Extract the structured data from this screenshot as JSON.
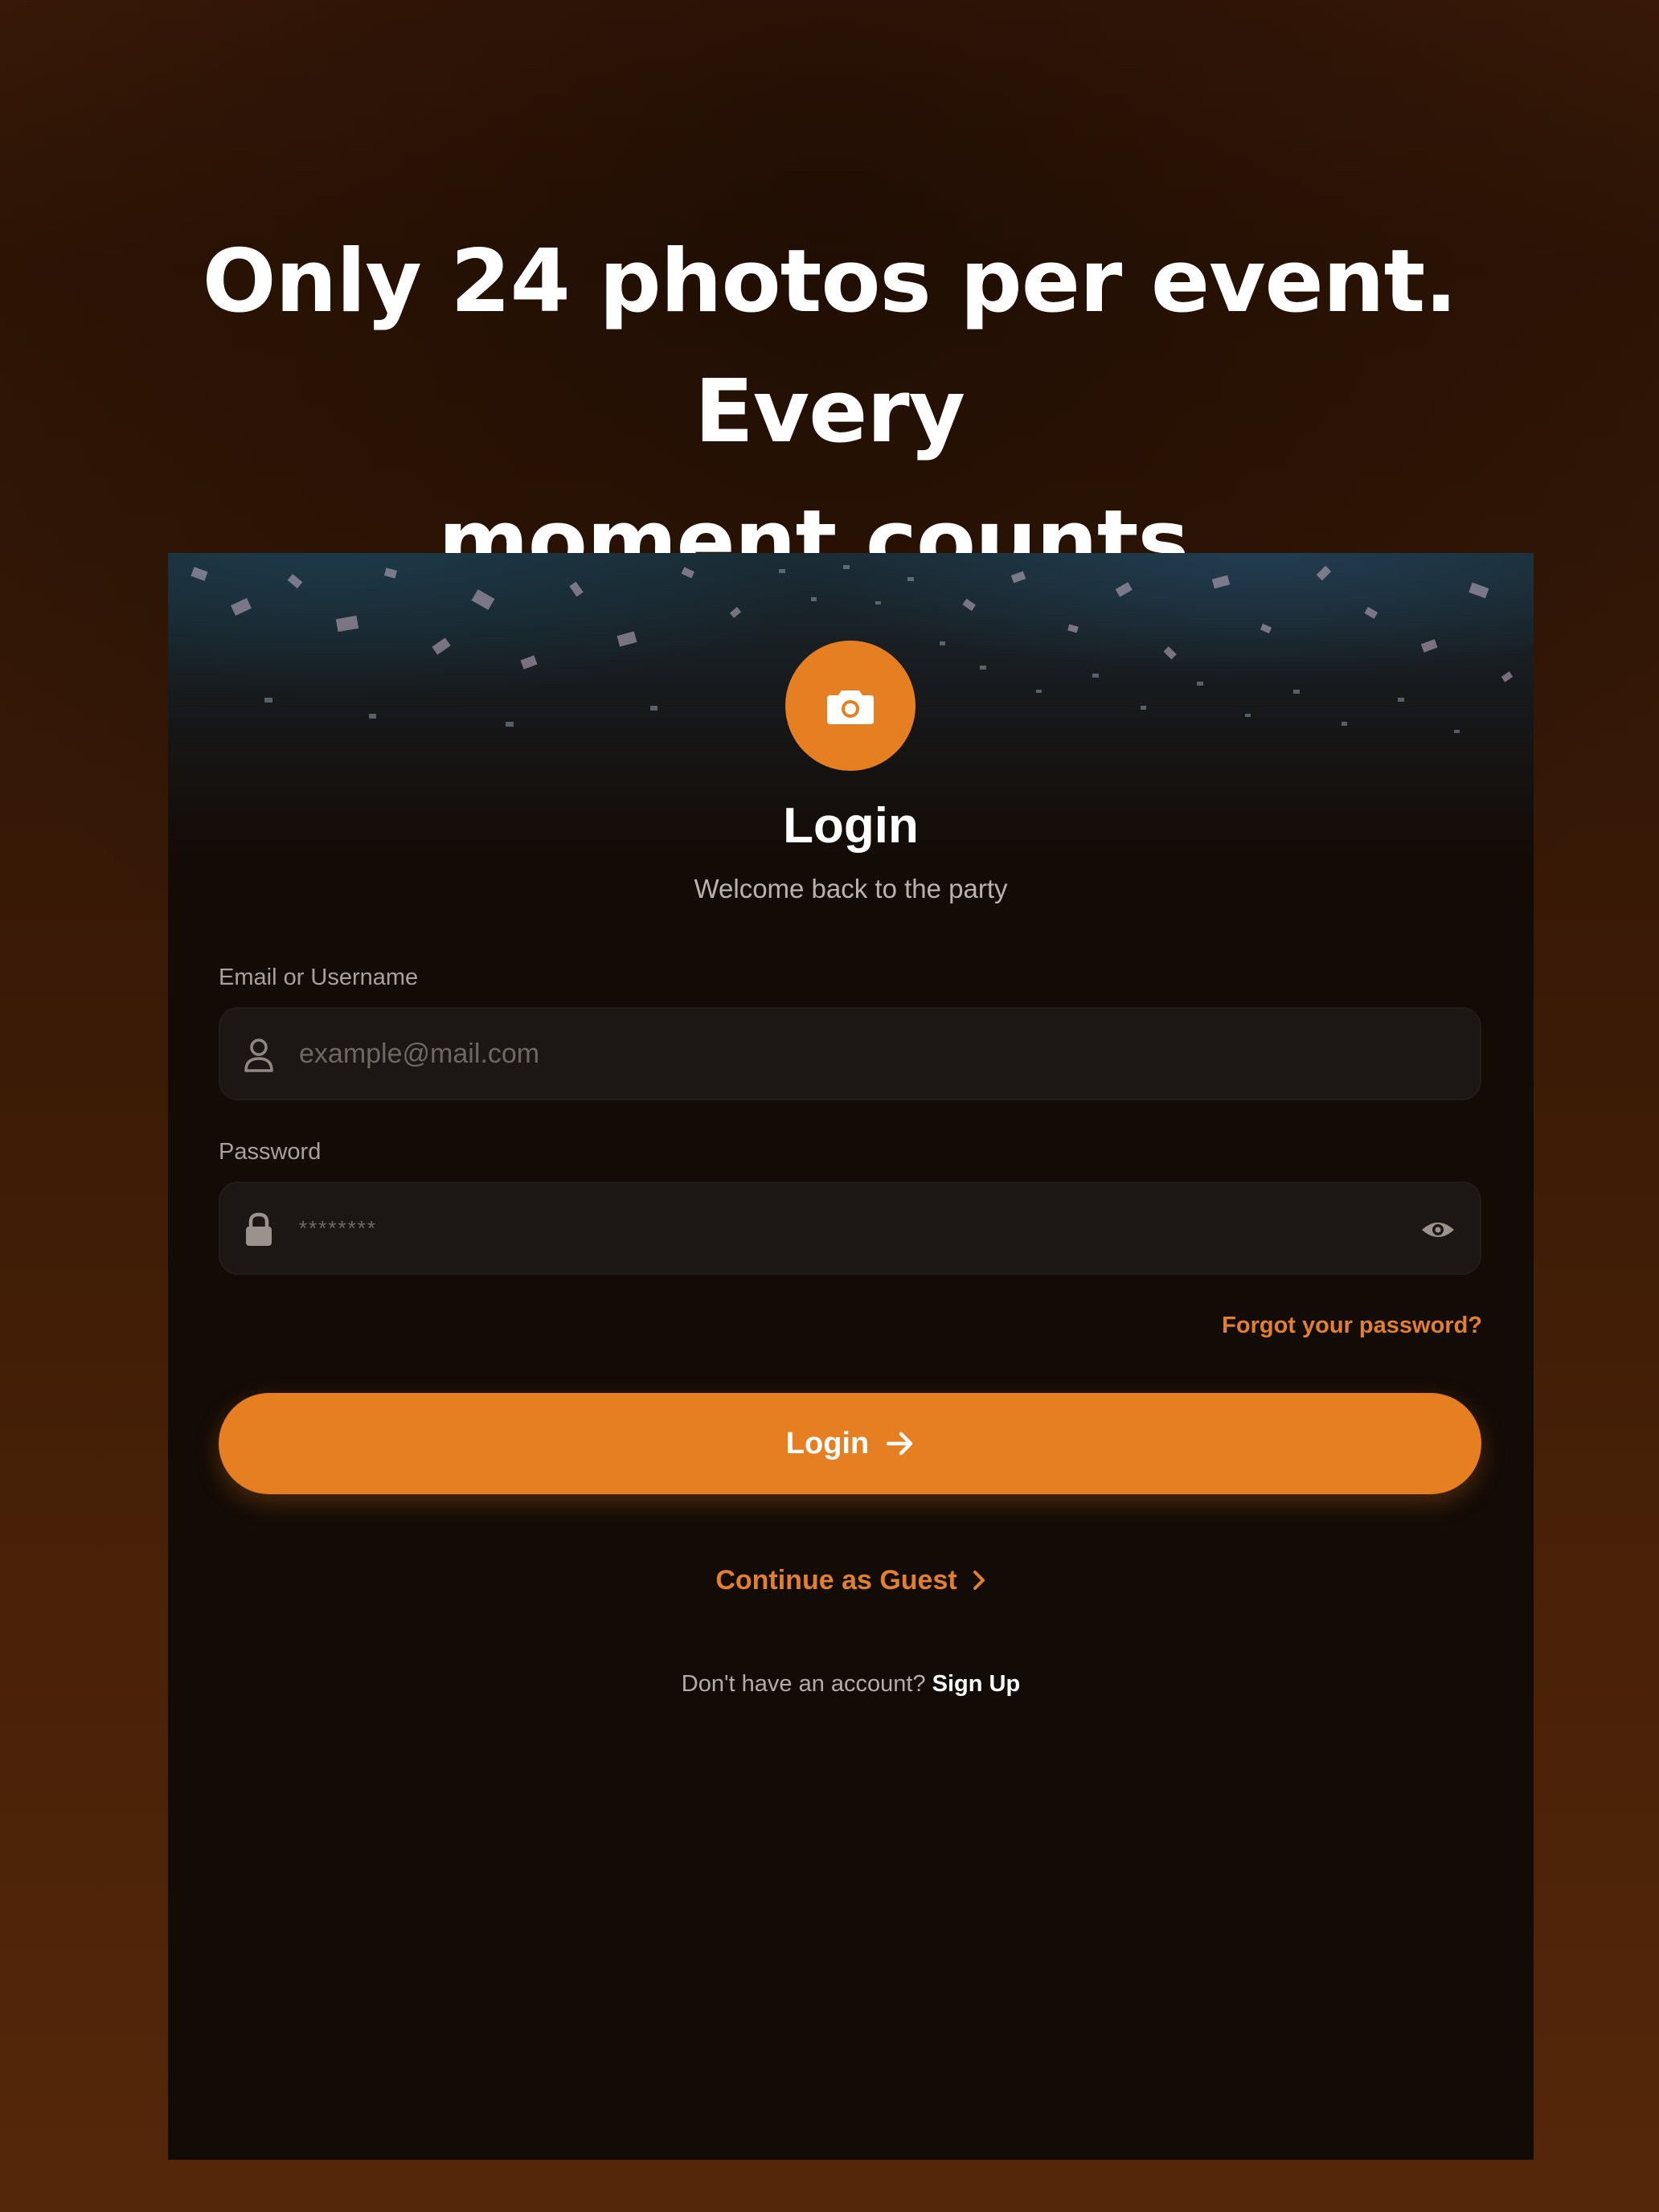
{
  "headline": {
    "line1": "Only 24 photos per event. Every",
    "line2": "moment counts."
  },
  "login_screen": {
    "logo_icon": "camera-icon",
    "title": "Login",
    "subtitle": "Welcome back to the party",
    "email": {
      "label": "Email or Username",
      "placeholder": "example@mail.com",
      "icon": "user-icon"
    },
    "password": {
      "label": "Password",
      "placeholder": "********",
      "icon": "lock-icon",
      "toggle_icon": "eye-icon"
    },
    "forgot_link": "Forgot your password?",
    "login_button": {
      "label": "Login",
      "icon": "arrow-right-icon"
    },
    "guest_link": {
      "label": "Continue as Guest",
      "icon": "chevron-right-icon"
    },
    "signup": {
      "prompt": "Don't have an account?",
      "link": "Sign Up"
    }
  },
  "colors": {
    "accent": "#e67e22",
    "background_gradient_top": "#3b1a08",
    "background_gradient_bottom": "#55270a",
    "screen_background": "#130b06",
    "field_background": "#1c1714"
  }
}
